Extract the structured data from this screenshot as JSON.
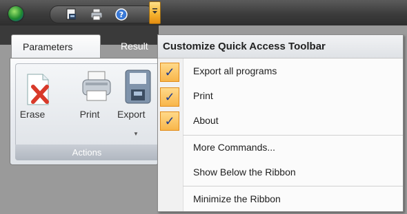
{
  "qat": {
    "orb_icon": "app-orb-icon",
    "buttons": [
      {
        "icon": "export-programs-icon"
      },
      {
        "icon": "print-icon"
      },
      {
        "icon": "about-icon"
      }
    ],
    "customize_icon": "chevron-down-icon"
  },
  "ribbon": {
    "tabs": [
      {
        "label": "Parameters",
        "active": true
      },
      {
        "label": "Result",
        "active": false
      }
    ],
    "group": {
      "label": "Actions",
      "buttons": [
        {
          "label": "Erase",
          "icon": "erase-icon"
        },
        {
          "label": "Print",
          "icon": "print-icon"
        },
        {
          "label": "Export",
          "icon": "export-icon"
        }
      ]
    }
  },
  "menu": {
    "title": "Customize Quick Access Toolbar",
    "items": [
      {
        "label": "Export all programs",
        "checked": true
      },
      {
        "label": "Print",
        "checked": true
      },
      {
        "label": "About",
        "checked": true
      },
      {
        "label": "More Commands...",
        "checked": false
      },
      {
        "label": "Show Below the Ribbon",
        "checked": false
      },
      {
        "label": "Minimize the Ribbon",
        "checked": false
      }
    ],
    "check_glyph": "✓"
  },
  "colors": {
    "accent": "#f8b64a",
    "check": "#1d3c8f"
  }
}
